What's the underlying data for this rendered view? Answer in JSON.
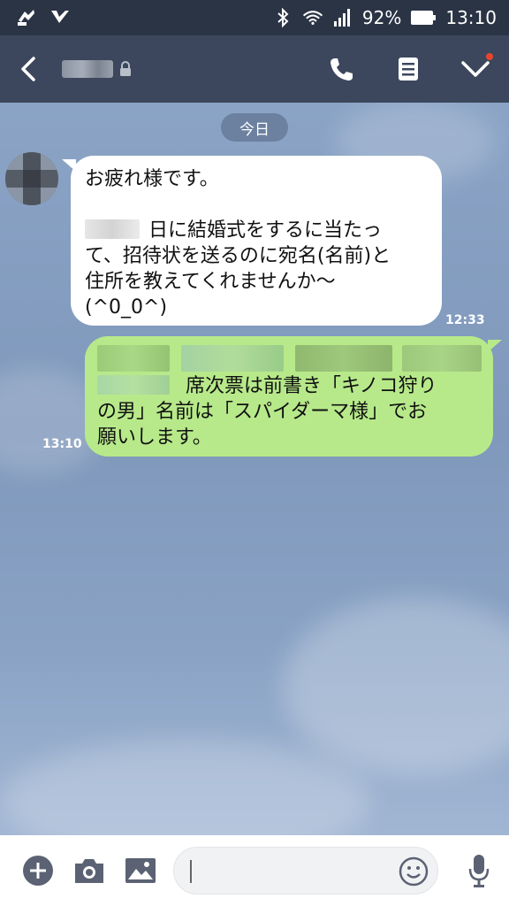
{
  "status_bar": {
    "battery_percent": "92%",
    "time": "13:10",
    "icons": [
      "notification-icon",
      "check-app-icon",
      "bluetooth-icon",
      "wifi-icon",
      "signal-icon",
      "battery-icon"
    ]
  },
  "header": {
    "icons": [
      "back-icon",
      "lock-icon",
      "phone-icon",
      "menu-icon",
      "chevron-down-icon"
    ]
  },
  "chat": {
    "date_label": "今日",
    "incoming": {
      "line1": "お疲れ様です。",
      "line2_after_blur": "日に結婚式をするに当たっ",
      "line3": "て、招待状を送るのに宛名(名前)と",
      "line4": "住所を教えてくれませんか〜",
      "line5": "(^0_0^)",
      "time": "12:33"
    },
    "outgoing": {
      "line2_after_blur": "席次票は前書き「キノコ狩り",
      "line3": "の男」名前は「スパイダーマ様」でお",
      "line4": "願いします。",
      "time": "13:10"
    }
  },
  "input_bar": {
    "icons": [
      "plus-icon",
      "camera-icon",
      "image-icon",
      "emoji-icon",
      "mic-icon"
    ],
    "message_value": ""
  },
  "colors": {
    "status_bar_bg": "#2a3445",
    "header_bg": "#3c475d",
    "chat_bg": "#8ba4c6",
    "incoming_bubble": "#ffffff",
    "outgoing_bubble": "#b7e98a"
  }
}
